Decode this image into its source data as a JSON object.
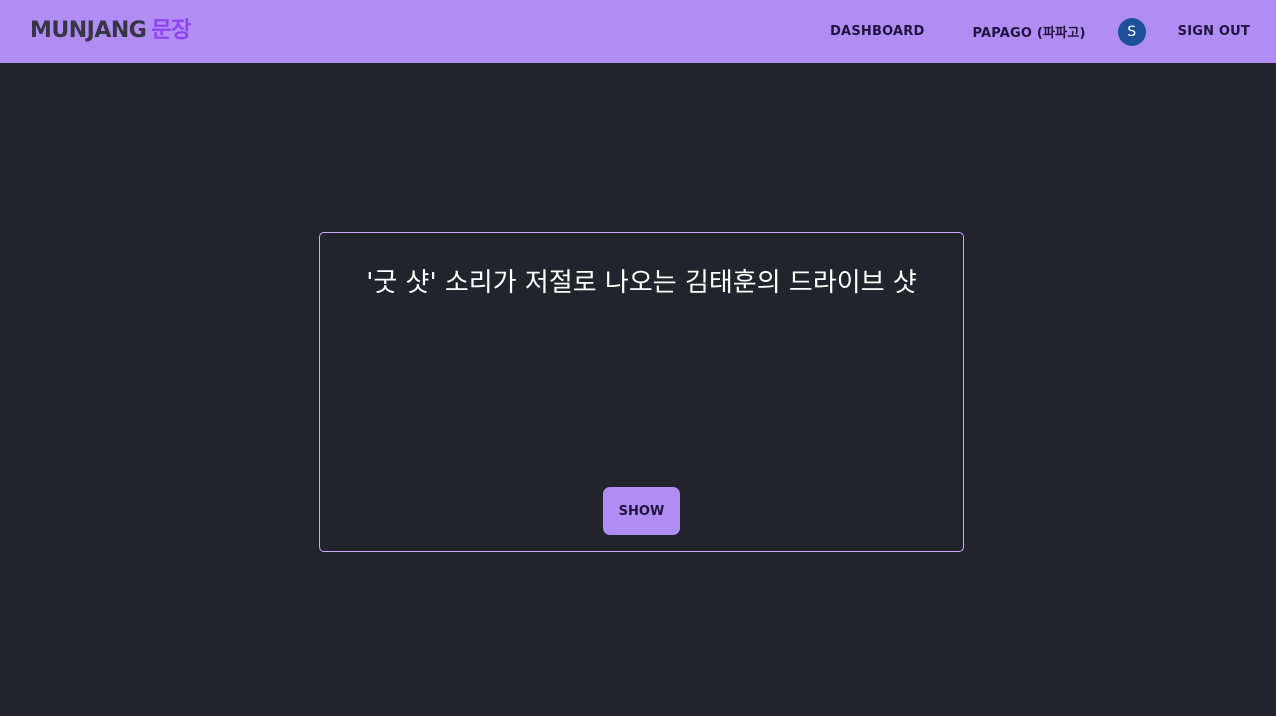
{
  "header": {
    "logo_en": "MUNJANG",
    "logo_ko": "문장",
    "nav": {
      "dashboard": "DASHBOARD",
      "papago": "PAPAGO (파파고)",
      "avatar_initial": "S",
      "sign_out": "SIGN OUT"
    }
  },
  "card": {
    "sentence": "'굿 샷' 소리가 저절로 나오는 김태훈의 드라이브 샷",
    "show_label": "SHOW"
  },
  "colors": {
    "background": "#22232c",
    "header": "#b18df3",
    "accent": "#8f44f2",
    "avatar": "#1e4f9a",
    "card_border": "#c9a9f7"
  }
}
